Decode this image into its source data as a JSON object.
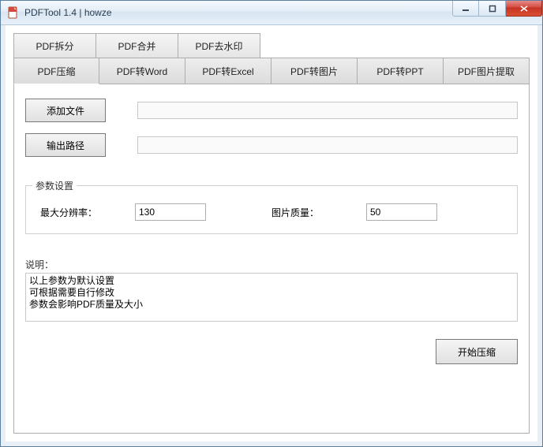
{
  "window": {
    "title": "PDFTool 1.4 |  howze"
  },
  "tabs": {
    "row1": [
      {
        "label": "PDF拆分"
      },
      {
        "label": "PDF合并"
      },
      {
        "label": "PDF去水印"
      }
    ],
    "row2": [
      {
        "label": "PDF压缩",
        "active": true
      },
      {
        "label": "PDF转Word"
      },
      {
        "label": "PDF转Excel"
      },
      {
        "label": "PDF转图片"
      },
      {
        "label": "PDF转PPT"
      },
      {
        "label": "PDF图片提取"
      }
    ]
  },
  "buttons": {
    "add_file": "添加文件",
    "output_path": "输出路径",
    "start": "开始压缩"
  },
  "fields": {
    "input_path_value": "",
    "output_path_value": ""
  },
  "params": {
    "legend": "参数设置",
    "max_res_label": "最大分辨率：",
    "max_res_value": "130",
    "quality_label": "图片质量：",
    "quality_value": "50"
  },
  "description": {
    "label": "说明：",
    "text": "以上参数为默认设置\n可根据需要自行修改\n参数会影响PDF质量及大小"
  }
}
